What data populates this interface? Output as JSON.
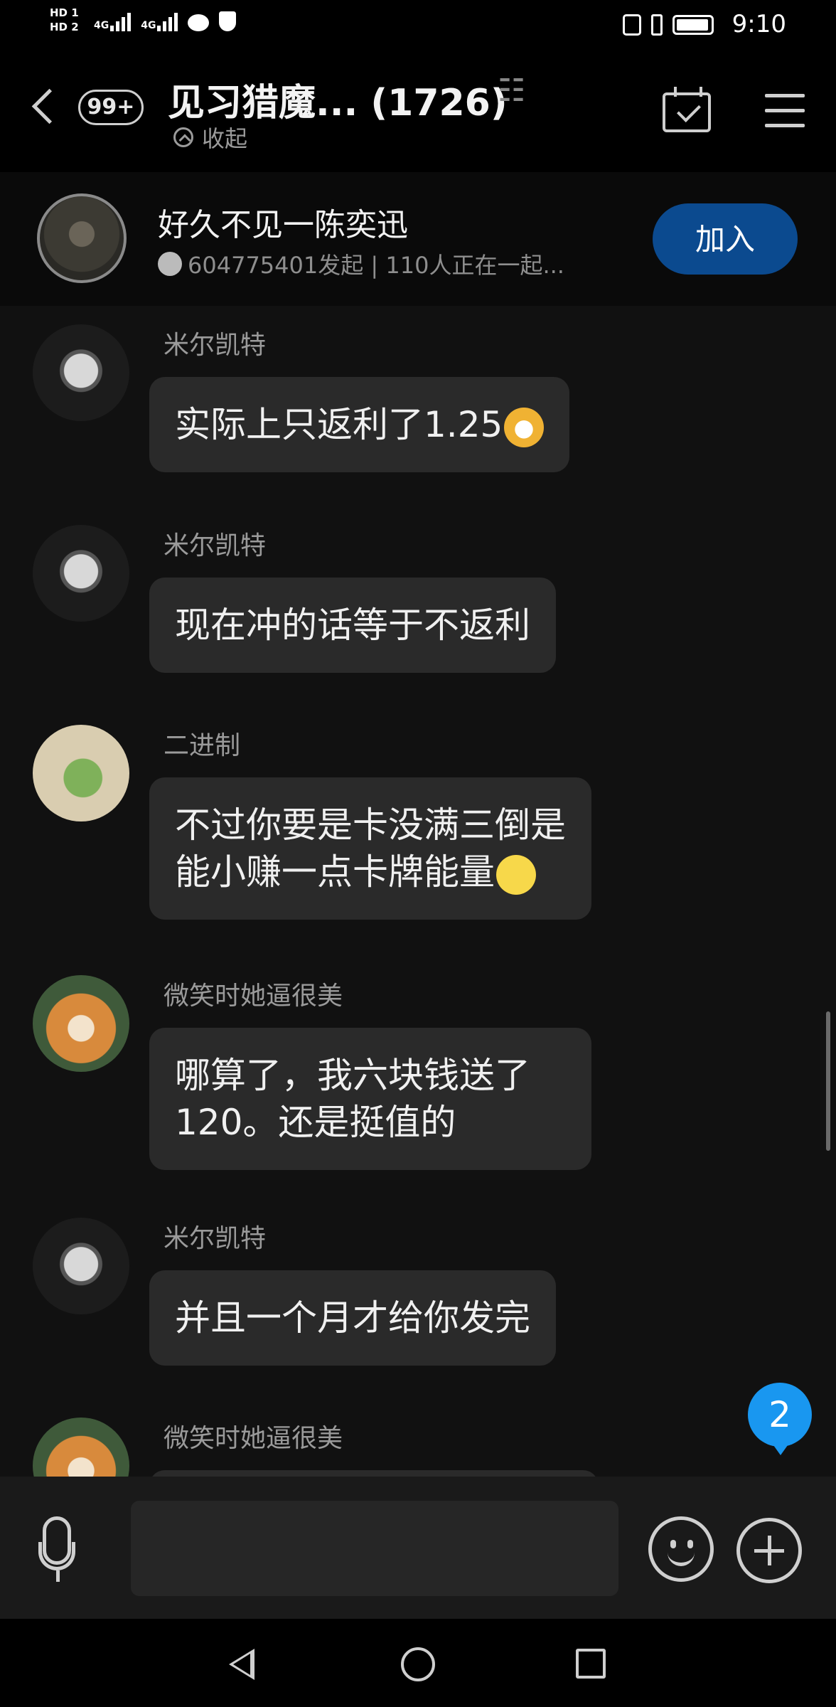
{
  "status_bar": {
    "hd1": "HD 1",
    "hd2": "HD 2",
    "net1": "4G",
    "net2": "4G",
    "time": "9:10"
  },
  "header": {
    "unread_badge": "99+",
    "title": "见习猎魔... (1726)",
    "collapse_label": "收起"
  },
  "live": {
    "title": "好久不见一陈奕迅",
    "subtitle": "604775401发起 | 110人正在一起...",
    "join_label": "加入"
  },
  "messages": [
    {
      "sender": "米尔凯特",
      "text": "实际上只返利了1.25",
      "emoji": "cat-face"
    },
    {
      "sender": "米尔凯特",
      "text": "现在冲的话等于不返利"
    },
    {
      "sender": "二进制",
      "line1": "不过你要是卡没满三倒是",
      "line2": "能小赚一点卡牌能量",
      "emoji": "smirk-face"
    },
    {
      "sender": "微笑时她逼很美",
      "line1": "哪算了，我六块钱送了",
      "line2": "120。还是挺值的"
    },
    {
      "sender": "米尔凯特",
      "text": "并且一个月才给你发完"
    },
    {
      "sender": "微笑时她逼很美"
    }
  ],
  "new_message_badge": "2",
  "input": {
    "placeholder": ""
  },
  "icons": [
    "back-icon",
    "ear-icon",
    "calendar-check-icon",
    "menu-icon",
    "mic-icon",
    "emoji-icon",
    "plus-icon",
    "nav-back-icon",
    "nav-home-icon",
    "nav-recent-icon"
  ]
}
